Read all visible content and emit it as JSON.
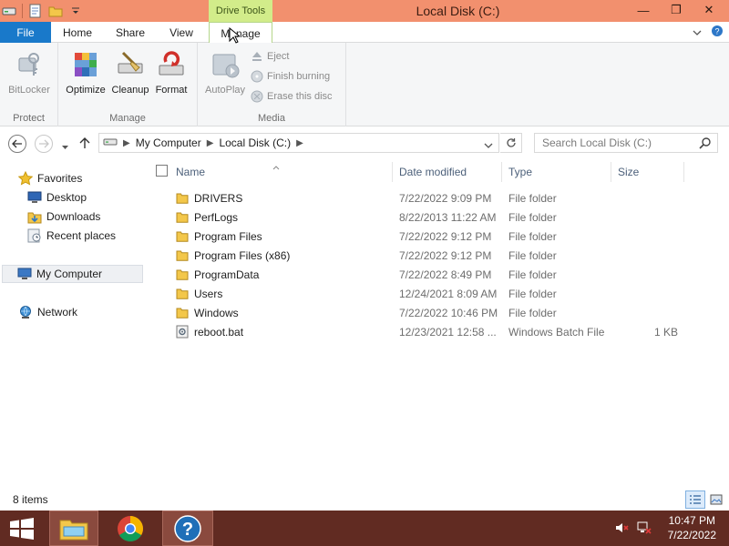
{
  "window": {
    "title": "Local Disk (C:)",
    "contextual_header": "Drive Tools",
    "controls": {
      "minimize": "—",
      "restore": "❐",
      "close": "✕"
    }
  },
  "ribbon": {
    "tabs": {
      "file": "File",
      "home": "Home",
      "share": "Share",
      "view": "View",
      "manage": "Manage"
    },
    "groups": {
      "protect": {
        "label": "Protect",
        "bitlocker": "BitLocker"
      },
      "manage": {
        "label": "Manage",
        "optimize": "Optimize",
        "cleanup": "Cleanup",
        "format": "Format"
      },
      "media": {
        "label": "Media",
        "autoplay": "AutoPlay",
        "eject": "Eject",
        "finish_burning": "Finish burning",
        "erase_disc": "Erase this disc"
      }
    },
    "colors": {
      "file_tab": "#1979ca",
      "titlebar": "#f2906e",
      "contextual": "#d2ec8a"
    }
  },
  "address": {
    "crumbs": [
      "My Computer",
      "Local Disk (C:)"
    ],
    "search_placeholder": "Search Local Disk (C:)"
  },
  "nav": {
    "favorites": "Favorites",
    "desktop": "Desktop",
    "downloads": "Downloads",
    "recent": "Recent places",
    "computer": "My Computer",
    "network": "Network"
  },
  "columns": {
    "name": "Name",
    "date": "Date modified",
    "type": "Type",
    "size": "Size"
  },
  "files": [
    {
      "name": "DRIVERS",
      "date": "7/22/2022 9:09 PM",
      "type": "File folder",
      "size": ""
    },
    {
      "name": "PerfLogs",
      "date": "8/22/2013 11:22 AM",
      "type": "File folder",
      "size": ""
    },
    {
      "name": "Program Files",
      "date": "7/22/2022 9:12 PM",
      "type": "File folder",
      "size": ""
    },
    {
      "name": "Program Files (x86)",
      "date": "7/22/2022 9:12 PM",
      "type": "File folder",
      "size": ""
    },
    {
      "name": "ProgramData",
      "date": "7/22/2022 8:49 PM",
      "type": "File folder",
      "size": ""
    },
    {
      "name": "Users",
      "date": "12/24/2021 8:09 AM",
      "type": "File folder",
      "size": ""
    },
    {
      "name": "Windows",
      "date": "7/22/2022 10:46 PM",
      "type": "File folder",
      "size": ""
    },
    {
      "name": "reboot.bat",
      "date": "12/23/2021 12:58 ...",
      "type": "Windows Batch File",
      "size": "1 KB"
    }
  ],
  "status": {
    "count": "8 items"
  },
  "taskbar": {
    "time": "10:47 PM",
    "date": "7/22/2022",
    "color": "#612b22"
  }
}
